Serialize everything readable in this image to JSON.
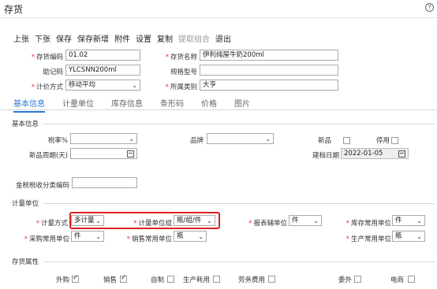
{
  "header": {
    "title": "存货",
    "help_icon": "?"
  },
  "toolbar": {
    "items": [
      "上张",
      "下张",
      "保存",
      "保存新增",
      "附件",
      "设置",
      "复制",
      "提取组合",
      "退出"
    ],
    "disabled_item": "提取组合"
  },
  "form": {
    "code_label": "存货编码",
    "code_value": "01.02",
    "name_label": "存货名称",
    "name_value": "伊利纯屋牛奶200ml",
    "mnemonic_label": "助记码",
    "mnemonic_value": "YLCSNN200ml",
    "spec_label": "规格型号",
    "spec_value": "",
    "valuation_label": "计价方式",
    "valuation_value": "移动平均",
    "category_label": "所属类别",
    "category_value": "大亨"
  },
  "tabs": [
    "基本信息",
    "计量单位",
    "库存信息",
    "条形码",
    "价格",
    "图片"
  ],
  "basic": {
    "section_title": "基本信息",
    "tax_label": "税率%",
    "tax_value": "",
    "brand_label": "品牌",
    "brand_value": "",
    "new_label": "新品",
    "disabled_label": "停用",
    "shelf_label": "新品周期(天)",
    "shelf_value": "",
    "created_label": "建档日期",
    "created_value": "2022-01-05",
    "tax_code_label": "金税税收分类编码",
    "tax_code_value": ""
  },
  "units": {
    "section_title": "计量单位",
    "method_label": "计量方式",
    "method_value": "多计量",
    "group_label": "计量单位组",
    "group_value": "瓶/组/件",
    "report_label": "报表辅单位",
    "report_value": "件",
    "stock_label": "库存常用单位",
    "stock_value": "件",
    "purchase_label": "采购常用单位",
    "purchase_value": "件",
    "sales_label": "销售常用单位",
    "sales_value": "瓶",
    "production_label": "生产常用单位",
    "production_value": "瓶"
  },
  "attrs": {
    "section_title": "存货属性",
    "items": [
      {
        "label": "外购",
        "checked": true
      },
      {
        "label": "销售",
        "checked": true
      },
      {
        "label": "自制",
        "checked": false
      },
      {
        "label": "生产耗用",
        "checked": false
      },
      {
        "label": "劳务费用",
        "checked": false
      },
      {
        "label": "委外",
        "checked": false
      },
      {
        "label": "电商",
        "checked": false
      }
    ]
  }
}
